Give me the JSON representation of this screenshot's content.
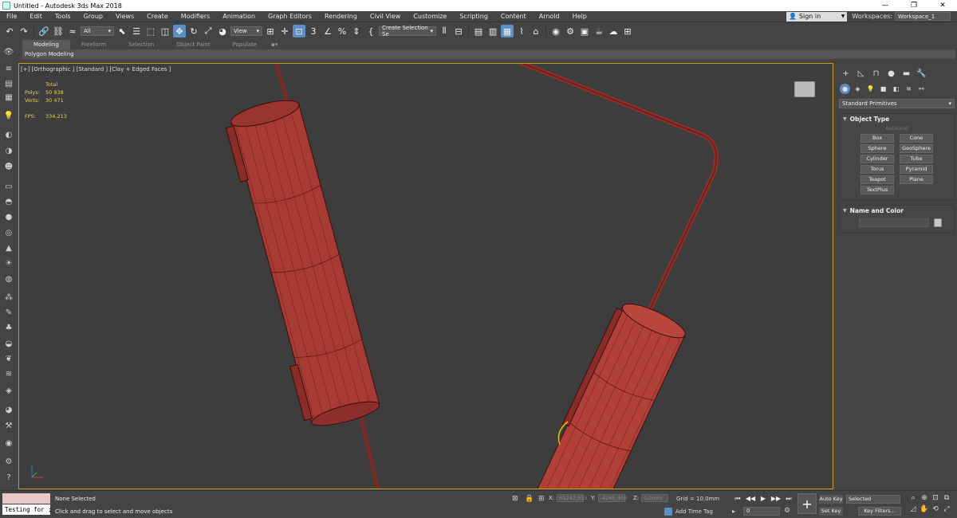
{
  "window": {
    "title": "Untitled - Autodesk 3ds Max 2018",
    "minimize": "—",
    "maximize": "❐",
    "close": "✕"
  },
  "menu": {
    "items": [
      "File",
      "Edit",
      "Tools",
      "Group",
      "Views",
      "Create",
      "Modifiers",
      "Animation",
      "Graph Editors",
      "Rendering",
      "Civil View",
      "Customize",
      "Scripting",
      "Content",
      "Arnold",
      "Help"
    ],
    "sign_in": "Sign in",
    "workspaces_label": "Workspaces:",
    "workspace_value": "Workspace_1"
  },
  "toolbar": {
    "selection_filter": "All",
    "reference_coord": "View",
    "snap_value": "3",
    "named_selection": "Create Selection Se"
  },
  "ribbon": {
    "tabs": [
      "Modeling",
      "Freeform",
      "Selection",
      "Object Paint",
      "Populate"
    ],
    "active_tab": "Modeling",
    "panel_label": "Polygon Modeling"
  },
  "viewport": {
    "label": "[+] [Orthographic ] [Standard ] [Clay + Edged Faces ]",
    "stats": {
      "total_label": "Total",
      "polys_label": "Polys:",
      "polys_value": "50 938",
      "verts_label": "Verts:",
      "verts_value": "30 471",
      "fps_label": "FPS:",
      "fps_value": "334,213"
    },
    "object_color": "#a83a34"
  },
  "command_panel": {
    "category": "Standard Primitives",
    "object_type_title": "Object Type",
    "autogrid": "AutoGrid",
    "buttons": [
      "Box",
      "Cone",
      "Sphere",
      "GeoSphere",
      "Cylinder",
      "Tube",
      "Torus",
      "Pyramid",
      "Teapot",
      "Plane",
      "TextPlus"
    ],
    "name_color_title": "Name and Color"
  },
  "status": {
    "maxscript": "Testing for ;",
    "selection": "None Selected",
    "prompt": "Click and drag to select and move objects",
    "x_label": "X:",
    "x_value": "65247,953",
    "y_label": "Y:",
    "y_value": "-4265,409",
    "z_label": "Z:",
    "z_value": "0,0mm",
    "grid": "Grid = 10,0mm",
    "add_time_tag": "Add Time Tag",
    "frame": "0",
    "auto_key": "Auto Key",
    "set_key": "Set Key",
    "key_mode": "Selected",
    "key_filters": "Key Filters..."
  }
}
